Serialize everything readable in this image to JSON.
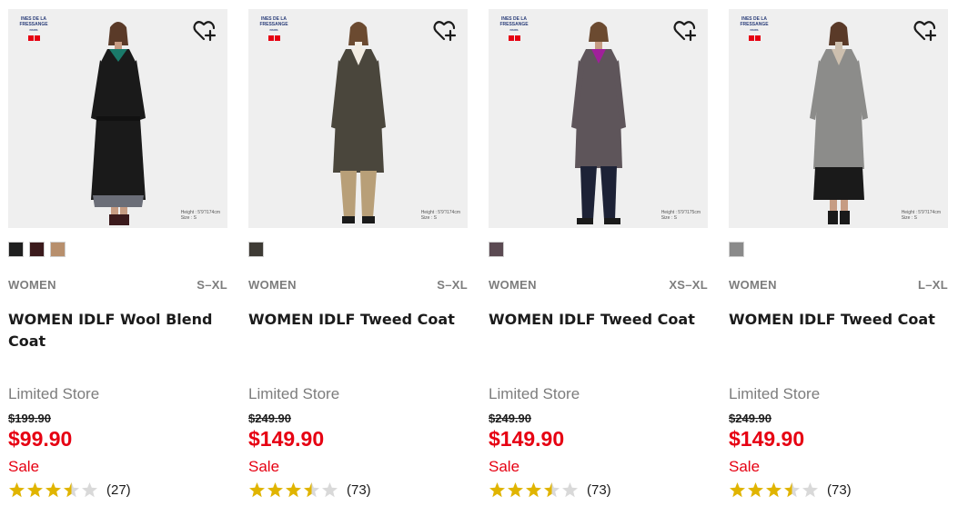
{
  "colors": {
    "sale_red": "#e60012",
    "star_gold": "#e0b400",
    "star_empty": "#d9d9d9"
  },
  "icons": {
    "wishlist": "heart-plus-icon",
    "star": "star-icon"
  },
  "products": [
    {
      "brand_name": "INES DE LA FRESSANGE",
      "brand_sub": "PARIS",
      "photo_caption_1": "Height : 5'9\"/174cm",
      "photo_caption_2": "Size : S",
      "swatches": [
        "#1f1f1f",
        "#3b1a1c",
        "#b78f6d"
      ],
      "gender": "WOMEN",
      "sizes": "S–XL",
      "name": "WOMEN IDLF Wool Blend Coat",
      "availability": "Limited Store",
      "original_price": "$199.90",
      "price": "$99.90",
      "flag": "Sale",
      "rating": 3.5,
      "review_count": "(27)"
    },
    {
      "brand_name": "INES DE LA FRESSANGE",
      "brand_sub": "PARIS",
      "photo_caption_1": "Height : 5'9\"/174cm",
      "photo_caption_2": "Size : S",
      "swatches": [
        "#3e3b35"
      ],
      "gender": "WOMEN",
      "sizes": "S–XL",
      "name": "WOMEN IDLF Tweed Coat",
      "availability": "Limited Store",
      "original_price": "$249.90",
      "price": "$149.90",
      "flag": "Sale",
      "rating": 3.5,
      "review_count": "(73)"
    },
    {
      "brand_name": "INES DE LA FRESSANGE",
      "brand_sub": "PARIS",
      "photo_caption_1": "Height : 5'9\"/175cm",
      "photo_caption_2": "Size : S",
      "swatches": [
        "#5b4a52"
      ],
      "gender": "WOMEN",
      "sizes": "XS–XL",
      "name": "WOMEN IDLF Tweed Coat",
      "availability": "Limited Store",
      "original_price": "$249.90",
      "price": "$149.90",
      "flag": "Sale",
      "rating": 3.5,
      "review_count": "(73)"
    },
    {
      "brand_name": "INES DE LA FRESSANGE",
      "brand_sub": "PARIS",
      "photo_caption_1": "Height : 5'9\"/174cm",
      "photo_caption_2": "Size : S",
      "swatches": [
        "#8a8a8a"
      ],
      "gender": "WOMEN",
      "sizes": "L–XL",
      "name": "WOMEN IDLF Tweed Coat",
      "availability": "Limited Store",
      "original_price": "$249.90",
      "price": "$149.90",
      "flag": "Sale",
      "rating": 3.5,
      "review_count": "(73)"
    }
  ]
}
